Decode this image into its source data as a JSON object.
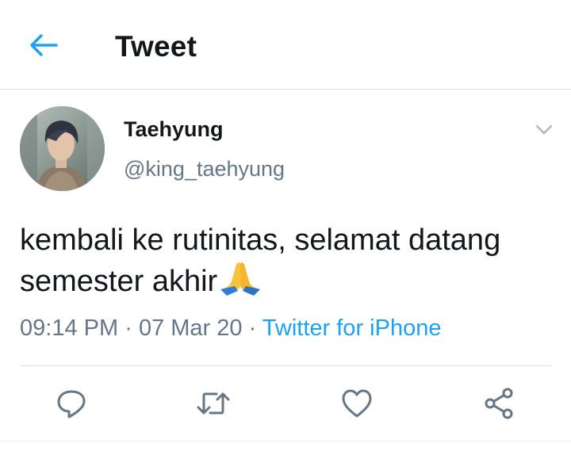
{
  "header": {
    "title": "Tweet",
    "back_icon": "arrow-left-icon"
  },
  "tweet": {
    "author_name": "Taehyung",
    "author_handle": "@king_taehyung",
    "text": "kembali ke rutinitas, selamat datang semester akhir",
    "emoji": "folded-hands-emoji",
    "time": "09:14 PM",
    "date": "07 Mar 20",
    "separator": "·",
    "source": "Twitter for iPhone"
  },
  "actions": [
    {
      "name": "reply",
      "icon": "reply-icon"
    },
    {
      "name": "retweet",
      "icon": "retweet-icon"
    },
    {
      "name": "like",
      "icon": "heart-icon"
    },
    {
      "name": "share",
      "icon": "share-icon"
    }
  ],
  "colors": {
    "accent": "#1da1f2",
    "text": "#14171a",
    "secondary": "#657786",
    "icon": "#657786",
    "divider": "#d9dde1"
  }
}
